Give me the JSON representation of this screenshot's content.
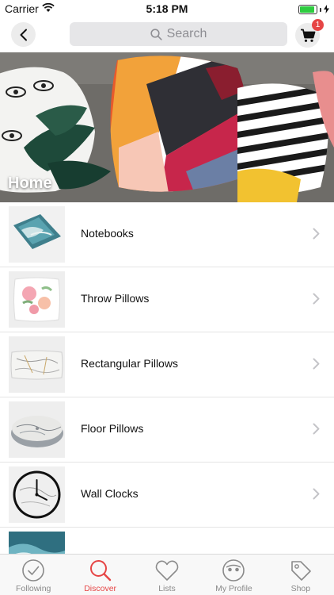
{
  "status_bar": {
    "carrier": "Carrier",
    "time": "5:18 PM",
    "battery_fill": 0.9
  },
  "nav": {
    "search_placeholder": "Search",
    "cart_count": "1"
  },
  "hero": {
    "title": "Home"
  },
  "categories": [
    {
      "label": "Notebooks",
      "thumb": "notebook-thumbnail"
    },
    {
      "label": "Throw Pillows",
      "thumb": "throw-pillow-thumbnail"
    },
    {
      "label": "Rectangular Pillows",
      "thumb": "rectangular-pillow-thumbnail"
    },
    {
      "label": "Floor Pillows",
      "thumb": "floor-pillow-thumbnail"
    },
    {
      "label": "Wall Clocks",
      "thumb": "wall-clock-thumbnail"
    },
    {
      "label": "",
      "thumb": "partial-thumbnail"
    }
  ],
  "tabs": [
    {
      "label": "Following",
      "icon": "check-circle-icon",
      "active": false
    },
    {
      "label": "Discover",
      "icon": "search-icon",
      "active": true
    },
    {
      "label": "Lists",
      "icon": "heart-icon",
      "active": false
    },
    {
      "label": "My Profile",
      "icon": "face-icon",
      "active": false
    },
    {
      "label": "Shop",
      "icon": "tag-icon",
      "active": false
    }
  ],
  "colors": {
    "accent": "#e64545",
    "inactive": "#8a8a8a",
    "battery": "#2ecc40"
  }
}
